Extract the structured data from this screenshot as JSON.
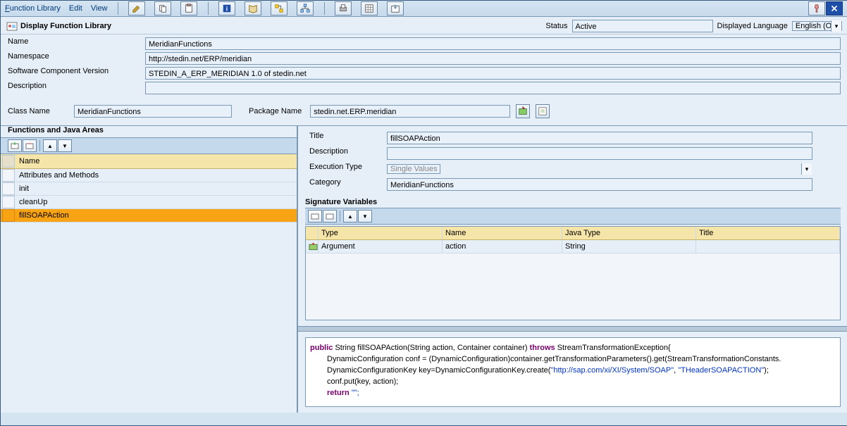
{
  "menu": {
    "function_library": "Function Library",
    "edit": "Edit",
    "view": "View"
  },
  "header": {
    "icon": "function-library-icon",
    "title": "Display Function Library",
    "status_label": "Status",
    "status_value": "Active",
    "lang_label": "Displayed Language",
    "lang_value": "English (OL)"
  },
  "form": {
    "name_label": "Name",
    "name_value": "MeridianFunctions",
    "namespace_label": "Namespace",
    "namespace_value": "http://stedin.net/ERP/meridian",
    "swcv_label": "Software Component Version",
    "swcv_value": "STEDIN_A_ERP_MERIDIAN 1.0 of stedin.net",
    "desc_label": "Description",
    "desc_value": ""
  },
  "classrow": {
    "classname_label": "Class Name",
    "classname_value": "MeridianFunctions",
    "package_label": "Package Name",
    "package_value": "stedin.net.ERP.meridian"
  },
  "left": {
    "title": "Functions and Java Areas",
    "col_header": "Name",
    "items": [
      "Attributes and Methods",
      "init",
      "cleanUp",
      "fillSOAPAction"
    ],
    "selected_index": 3
  },
  "right": {
    "title_label": "Title",
    "title_value": "fillSOAPAction",
    "desc_label": "Description",
    "desc_value": "",
    "exec_label": "Execution Type",
    "exec_value": "Single Values",
    "cat_label": "Category",
    "cat_value": "MeridianFunctions",
    "sig_title": "Signature Variables",
    "sig_headers": {
      "type": "Type",
      "name": "Name",
      "java": "Java Type",
      "title": "Title"
    },
    "sig_rows": [
      {
        "type": "Argument",
        "name": "action",
        "java": "String",
        "title": ""
      }
    ]
  },
  "code": {
    "sig_pre": "public",
    "sig_mid": " String fillSOAPAction(String action, Container container) ",
    "sig_throws": "throws",
    "sig_post": " StreamTransformationException{",
    "line1": "DynamicConfiguration conf = (DynamicConfiguration)container.getTransformationParameters().get(StreamTransformationConstants.",
    "line2a": "DynamicConfigurationKey key=DynamicConfigurationKey.create(",
    "url": "\"http://sap.com/xi/XI/System/SOAP\"",
    "comma": ", ",
    "header": "\"THeaderSOAPACTION\"",
    "line2b": ");",
    "line3": "conf.put(key, action);",
    "return_kw": "return",
    "return_rest": " \"\";"
  },
  "colors": {
    "accent": "#f7a313",
    "header_bg": "#f6e5a8"
  }
}
